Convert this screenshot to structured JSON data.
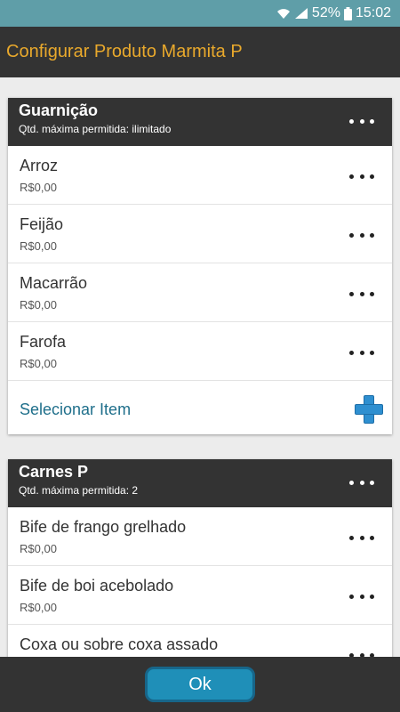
{
  "status_bar": {
    "battery": "52%",
    "time": "15:02",
    "icons": [
      "wifi-icon",
      "signal-icon",
      "battery-icon"
    ]
  },
  "app_bar": {
    "title": "Configurar Produto Marmita P",
    "title_color": "#e9a92c"
  },
  "groups": [
    {
      "title": "Guarnição",
      "subtitle": "Qtd. máxima permitida: ilimitado",
      "items": [
        {
          "name": "Arroz",
          "price": "R$0,00"
        },
        {
          "name": "Feijão",
          "price": "R$0,00"
        },
        {
          "name": "Macarrão",
          "price": "R$0,00"
        },
        {
          "name": "Farofa",
          "price": "R$0,00"
        }
      ],
      "select_label": "Selecionar Item"
    },
    {
      "title": "Carnes P",
      "subtitle": "Qtd. máxima permitida: 2",
      "items": [
        {
          "name": "Bife de frango grelhado",
          "price": "R$0,00"
        },
        {
          "name": "Bife de boi acebolado",
          "price": "R$0,00"
        },
        {
          "name": "Coxa ou sobre coxa assado",
          "price": ""
        }
      ]
    }
  ],
  "footer": {
    "ok_label": "Ok",
    "accent": "#1f8fb8"
  }
}
